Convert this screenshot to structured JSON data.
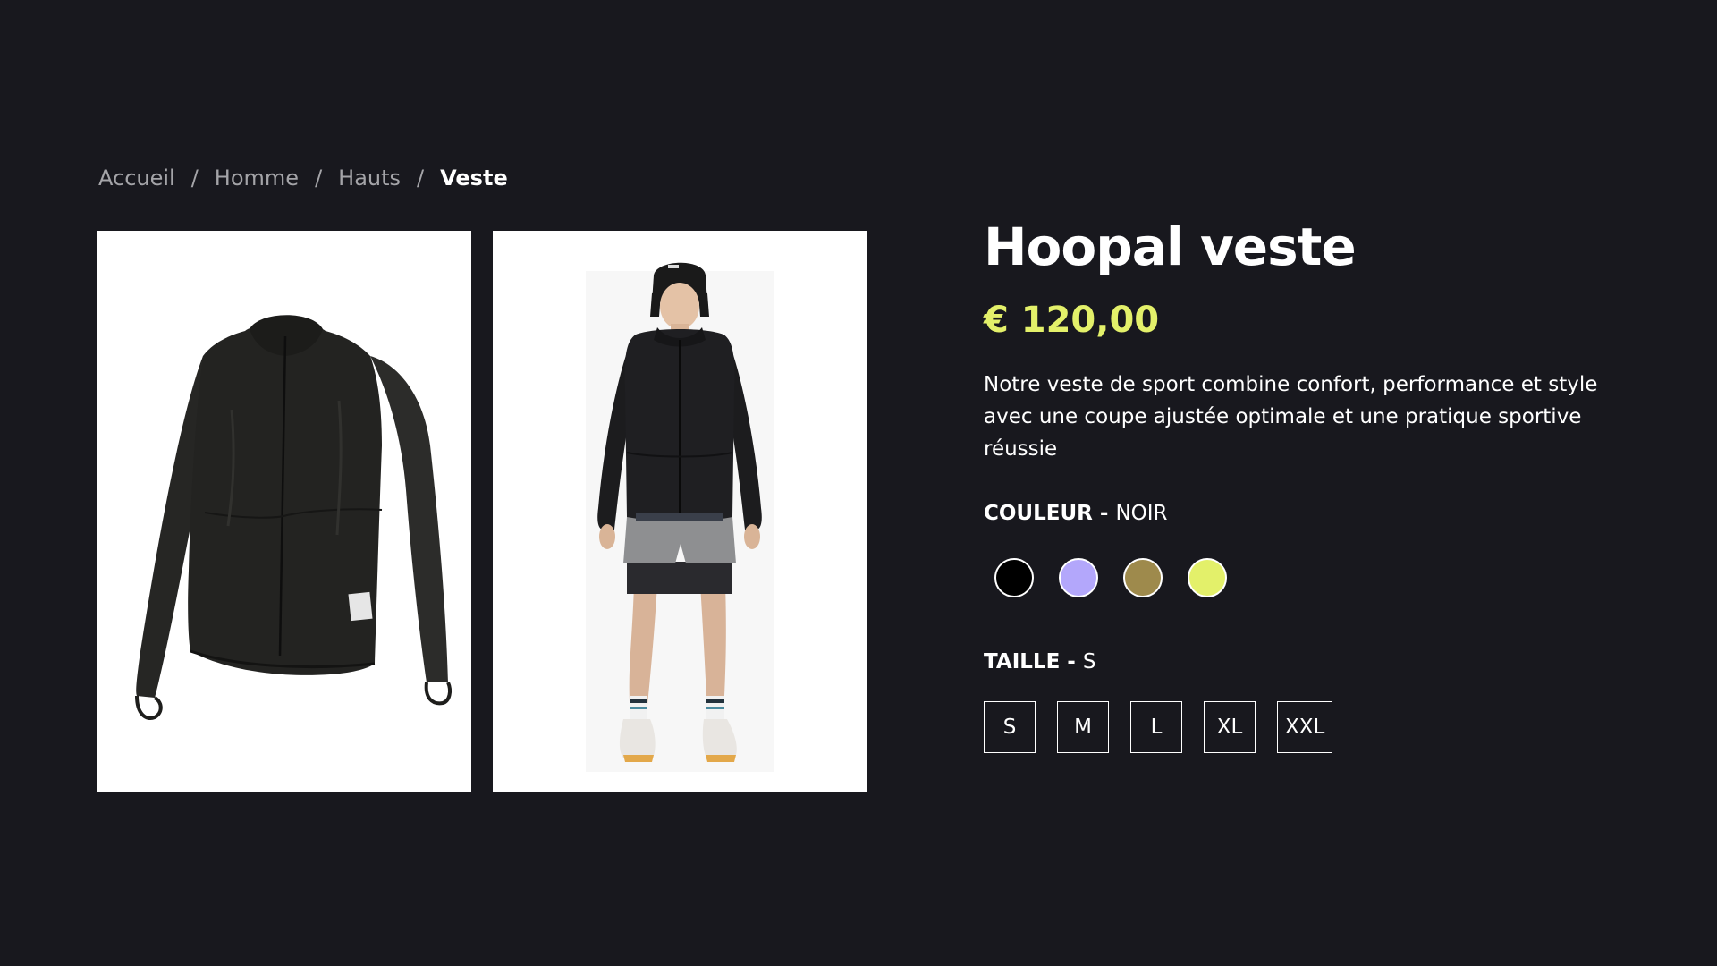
{
  "breadcrumb": {
    "items": [
      "Accueil",
      "Homme",
      "Hauts"
    ],
    "current": "Veste",
    "separator": "/"
  },
  "images": [
    {
      "alt": "Veste noire à plat",
      "icon": "jacket-product-photo"
    },
    {
      "alt": "Mannequin portant la veste",
      "icon": "model-wearing-jacket-photo"
    }
  ],
  "product": {
    "title": "Hoopal veste",
    "price": "€ 120,00",
    "description": "Notre veste de sport combine confort, performance et style avec une coupe ajustée optimale et une pratique sportive réussie"
  },
  "color_option": {
    "key": "COULEUR - ",
    "value": "NOIR",
    "swatches": [
      "#000000",
      "#b3a7fb",
      "#9e8a4c",
      "#e3f06a"
    ]
  },
  "size_option": {
    "key": "TAILLE - ",
    "value": "S",
    "sizes": [
      "S",
      "M",
      "L",
      "XL",
      "XXL"
    ]
  },
  "colors": {
    "background": "#18181e",
    "accent": "#e3f06a",
    "muted_text": "#a4a4a8"
  }
}
